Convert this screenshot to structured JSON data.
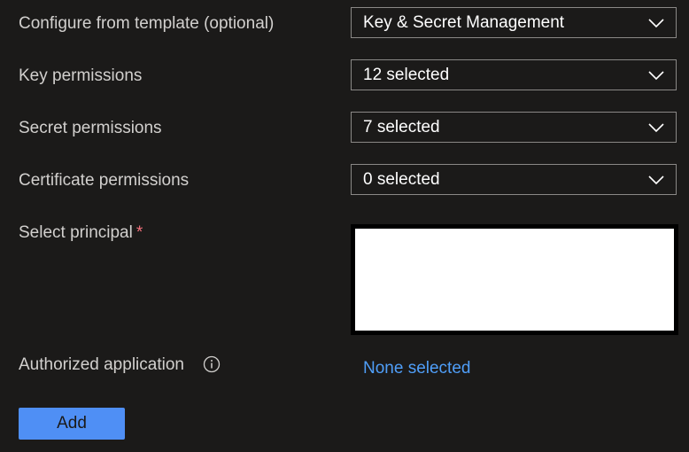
{
  "form": {
    "template": {
      "label": "Configure from template (optional)",
      "value": "Key & Secret Management"
    },
    "key_permissions": {
      "label": "Key permissions",
      "value": "12 selected"
    },
    "secret_permissions": {
      "label": "Secret permissions",
      "value": "7 selected"
    },
    "certificate_permissions": {
      "label": "Certificate permissions",
      "value": "0 selected"
    },
    "principal": {
      "label": "Select principal",
      "required_mark": "*"
    },
    "authorized_application": {
      "label": "Authorized application",
      "link": "None selected"
    },
    "add_button": "Add"
  },
  "icons": {
    "dropdown": "chevron-down-icon",
    "info": "info-icon"
  },
  "colors": {
    "background": "#1b1a19",
    "link": "#4f9ef8",
    "primary_button": "#4f8ff5",
    "required": "#f1707b"
  }
}
